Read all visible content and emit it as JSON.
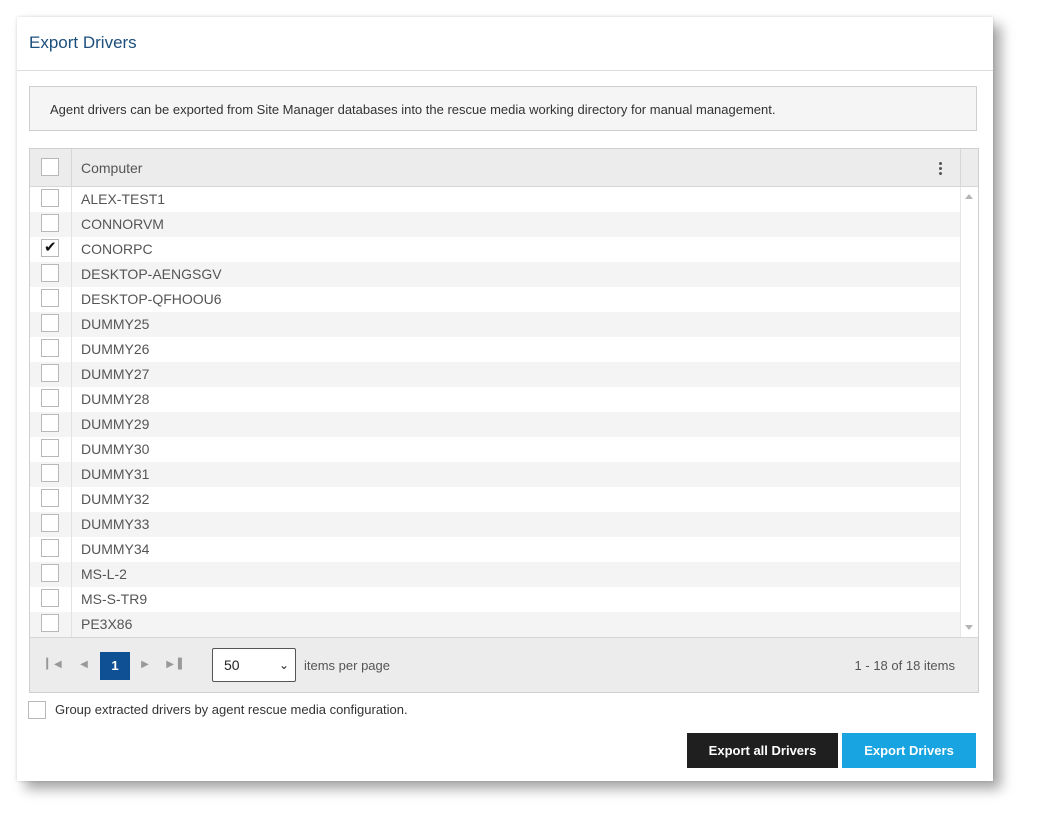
{
  "dialog": {
    "title": "Export Drivers",
    "info_text": "Agent drivers can be exported from Site Manager databases into the rescue media working directory for manual management."
  },
  "grid": {
    "header": {
      "column_label": "Computer",
      "select_all_checked": false
    },
    "rows": [
      {
        "name": "ALEX-TEST1",
        "checked": false
      },
      {
        "name": "CONNORVM",
        "checked": false
      },
      {
        "name": "CONORPC",
        "checked": true
      },
      {
        "name": "DESKTOP-AENGSGV",
        "checked": false
      },
      {
        "name": "DESKTOP-QFHOOU6",
        "checked": false
      },
      {
        "name": "DUMMY25",
        "checked": false
      },
      {
        "name": "DUMMY26",
        "checked": false
      },
      {
        "name": "DUMMY27",
        "checked": false
      },
      {
        "name": "DUMMY28",
        "checked": false
      },
      {
        "name": "DUMMY29",
        "checked": false
      },
      {
        "name": "DUMMY30",
        "checked": false
      },
      {
        "name": "DUMMY31",
        "checked": false
      },
      {
        "name": "DUMMY32",
        "checked": false
      },
      {
        "name": "DUMMY33",
        "checked": false
      },
      {
        "name": "DUMMY34",
        "checked": false
      },
      {
        "name": "MS-L-2",
        "checked": false
      },
      {
        "name": "MS-S-TR9",
        "checked": false
      },
      {
        "name": "PE3X86",
        "checked": false
      }
    ]
  },
  "pager": {
    "current_page": "1",
    "page_size": "50",
    "page_size_label": "items per page",
    "info": "1 - 18 of 18 items",
    "icons": {
      "first": "first-page-icon",
      "prev": "prev-page-icon",
      "next": "next-page-icon",
      "last": "last-page-icon"
    }
  },
  "options": {
    "group_label": "Group extracted drivers by agent rescue media configuration.",
    "group_checked": false
  },
  "buttons": {
    "export_all": "Export all Drivers",
    "export": "Export Drivers"
  },
  "colors": {
    "title": "#1c4f7c",
    "page_active": "#0f4f93",
    "primary_button": "#17a4e0",
    "dark_button": "#1f1f1f"
  }
}
